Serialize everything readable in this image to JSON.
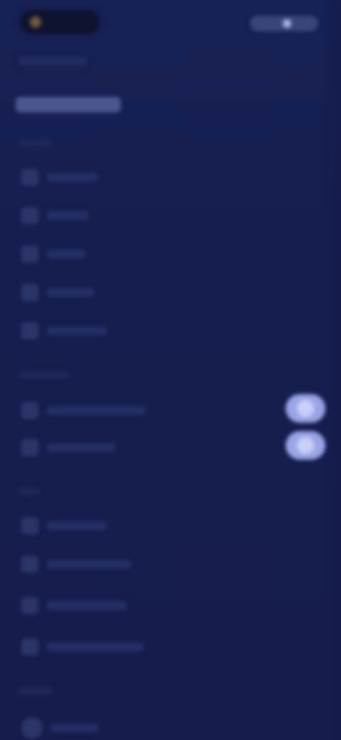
{
  "header": {
    "logo_text": "",
    "action_label": ""
  },
  "nav": {
    "selector_label": "",
    "sections": [
      {
        "label": ""
      },
      {
        "label": ""
      },
      {
        "label": ""
      },
      {
        "label": ""
      },
      {
        "label": ""
      }
    ],
    "group1": [
      {
        "label": "",
        "icon": "page-icon"
      },
      {
        "label": "",
        "icon": "page-icon"
      },
      {
        "label": "",
        "icon": "page-icon"
      },
      {
        "label": "",
        "icon": "page-icon"
      },
      {
        "label": "",
        "icon": "page-icon"
      }
    ],
    "group2": [
      {
        "label": "",
        "icon": "page-icon",
        "toggle": true
      },
      {
        "label": "",
        "icon": "page-icon",
        "toggle": true
      }
    ],
    "group3": [
      {
        "label": "",
        "icon": "page-icon"
      },
      {
        "label": "",
        "icon": "page-icon"
      },
      {
        "label": "",
        "icon": "page-icon"
      },
      {
        "label": "",
        "icon": "page-icon"
      }
    ],
    "group4": [
      {
        "label": "",
        "icon": "page-icon"
      }
    ]
  },
  "colors": {
    "background": "#172050",
    "accent": "#9aa5e6",
    "muted_text": "#4f5a8e"
  }
}
